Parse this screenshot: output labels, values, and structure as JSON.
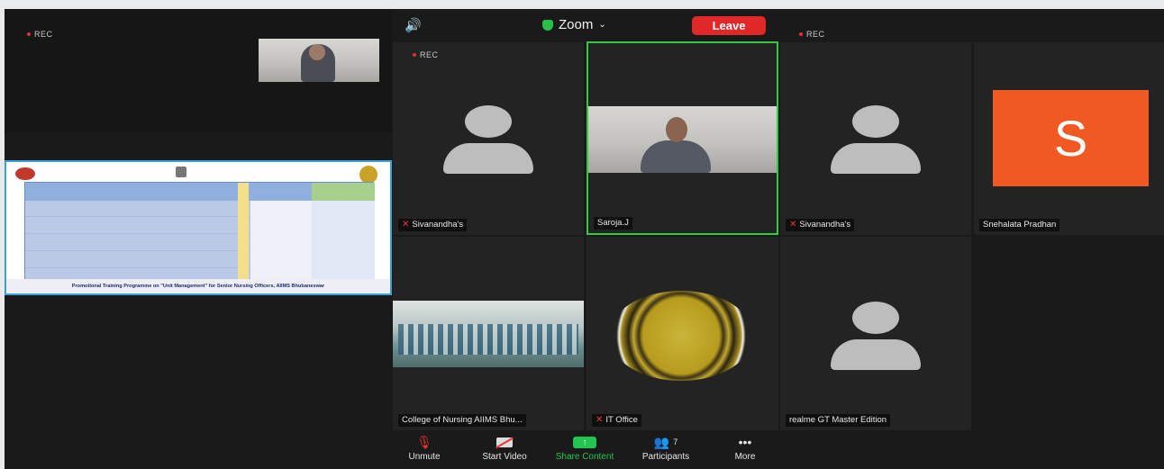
{
  "topbar": {
    "speaker_icon": "speaker-icon",
    "app_name": "Zoom",
    "leave_label": "Leave"
  },
  "rec_label": "REC",
  "slide": {
    "footer_text": "Promotional Training Programme on \"Unit Management\" for Senior Nursing Officers, AIIMS Bhubaneswar"
  },
  "participants": [
    {
      "name": "Sivanandha's",
      "muted": true
    },
    {
      "name": "Saroja.J",
      "muted": false
    },
    {
      "name": "Sivanandha's",
      "muted": true
    },
    {
      "name": "Snehalata Pradhan",
      "muted": false,
      "initial": "S"
    },
    {
      "name": "College of Nursing AIIMS Bhu...",
      "muted": false
    },
    {
      "name": "IT Office",
      "muted": true
    },
    {
      "name": "realme GT Master Edition",
      "muted": false
    }
  ],
  "toolbar": {
    "unmute": "Unmute",
    "start_video": "Start Video",
    "share_content": "Share Content",
    "participants": "Participants",
    "participants_count": "7",
    "more": "More"
  },
  "colors": {
    "leave": "#e02828",
    "active_speaker": "#2ecc40",
    "share": "#23c552",
    "avatar_orange": "#f05a22"
  }
}
